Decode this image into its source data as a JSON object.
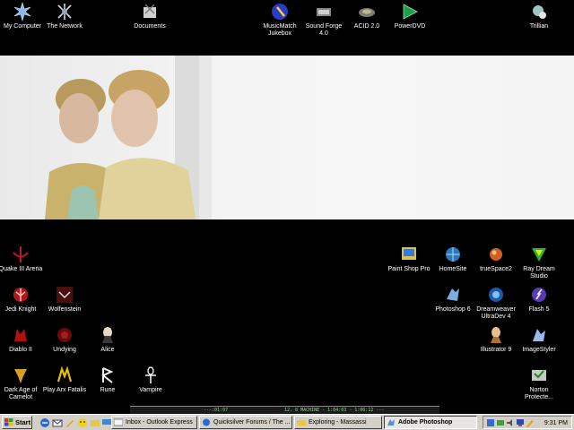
{
  "desktop": {
    "top_icons": [
      {
        "name": "my-computer-icon",
        "label": "My Computer"
      },
      {
        "name": "the-network-icon",
        "label": "The Network"
      },
      {
        "name": "documents-icon",
        "label": "Documents"
      },
      {
        "name": "musicmatch-jukebox-icon",
        "label": "MusicMatch Jukebox"
      },
      {
        "name": "sound-forge-icon",
        "label": "Sound Forge 4.0"
      },
      {
        "name": "acid-icon",
        "label": "ACID 2.0"
      },
      {
        "name": "powerdvd-icon",
        "label": "PowerDVD"
      },
      {
        "name": "trillian-icon",
        "label": "Trillian"
      }
    ],
    "left_icons": [
      {
        "name": "quake-iii-arena-icon",
        "label": "Quake III Arena"
      },
      {
        "name": "jedi-knight-icon",
        "label": "Jedi Knight"
      },
      {
        "name": "wolfenstein-icon",
        "label": "Wolfenstein"
      },
      {
        "name": "diablo-ii-icon",
        "label": "Diablo II"
      },
      {
        "name": "undying-icon",
        "label": "Undying"
      },
      {
        "name": "alice-icon",
        "label": "Alice"
      },
      {
        "name": "dark-age-of-camelot-icon",
        "label": "Dark Age of Camelot"
      },
      {
        "name": "play-arx-fatalis-icon",
        "label": "Play Arx Fatalis"
      },
      {
        "name": "rune-icon",
        "label": "Rune"
      },
      {
        "name": "vampire-icon",
        "label": "Vampire"
      }
    ],
    "right_icons": [
      {
        "name": "paint-shop-pro-icon",
        "label": "Paint Shop Pro"
      },
      {
        "name": "homesite-icon",
        "label": "HomeSite"
      },
      {
        "name": "truespace2-icon",
        "label": "trueSpace2"
      },
      {
        "name": "ray-dream-studio-icon",
        "label": "Ray Dream Studio"
      },
      {
        "name": "photoshop-6-icon",
        "label": "Photoshop 6"
      },
      {
        "name": "dreamweaver-ultradev-icon",
        "label": "Dreamweaver UltraDev 4"
      },
      {
        "name": "flash-5-icon",
        "label": "Flash 5"
      },
      {
        "name": "illustrator-9-icon",
        "label": "Illustrator 9"
      },
      {
        "name": "imagestyler-icon",
        "label": "ImageStyler"
      },
      {
        "name": "norton-protected-icon",
        "label": "Norton Protecte..."
      }
    ]
  },
  "winamp": {
    "segments": [
      "---:01:07",
      "12. 8 MACHINE - 1:04:03 - 1:06:12 ---"
    ]
  },
  "taskbar": {
    "start_label": "Start",
    "buttons": [
      {
        "label": "Inbox - Outlook Express",
        "active": false
      },
      {
        "label": "Quicksilver Forums / The ...",
        "active": false
      },
      {
        "label": "Exploring - Massassi",
        "active": false
      },
      {
        "label": "Adobe Photoshop",
        "active": true
      }
    ],
    "clock": "9:31 PM"
  },
  "colors": {
    "desktop_bg": "#000000",
    "taskbar_bg": "#d4d0c8",
    "wallpaper_bg": "#f2f2f2"
  }
}
